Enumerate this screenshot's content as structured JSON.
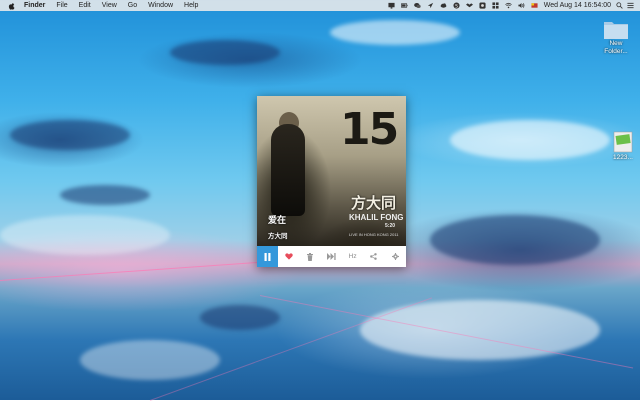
{
  "menubar": {
    "app_name": "Finder",
    "menus": [
      "File",
      "Edit",
      "View",
      "Go",
      "Window",
      "Help"
    ],
    "status_icons": [
      "apple-logo-icon",
      "display-icon",
      "battery-icon",
      "wechat-icon",
      "location-icon",
      "cloud-icon",
      "s-icon",
      "dropbox-icon",
      "app-icon",
      "grid-icon",
      "wifi-icon",
      "volume-icon",
      "flag-icon"
    ],
    "clock": "Wed Aug 14  16:54:00",
    "spotlight_icon": "search-icon",
    "notifications_icon": "list-icon"
  },
  "desktop": {
    "icons": [
      {
        "name": "new-folder-icon",
        "label_line1": "New",
        "label_line2": "Folder..."
      },
      {
        "name": "green-file-icon",
        "label_line1": "",
        "label_line2": "1223..."
      }
    ]
  },
  "player": {
    "track": {
      "title": "爱在",
      "artist": "方大同"
    },
    "cover": {
      "number": "15",
      "artist_text": "方大同",
      "tour_line1": "KHALIL FONG",
      "tour_line2": "5:20",
      "tour_line3": "LIVE IN HONG KONG 2011"
    },
    "controls": [
      {
        "name": "play-pause-button",
        "state": "playing"
      },
      {
        "name": "like-button",
        "icon": "heart-icon",
        "liked": true
      },
      {
        "name": "trash-button",
        "icon": "trash-icon"
      },
      {
        "name": "next-button",
        "icon": "next-icon"
      },
      {
        "name": "hz-button",
        "label": "Hz"
      },
      {
        "name": "share-button",
        "icon": "share-icon"
      },
      {
        "name": "settings-button",
        "icon": "gear-icon"
      }
    ],
    "hz_label": "Hz"
  },
  "colors": {
    "accent": "#3498db",
    "heart": "#e74c5b"
  }
}
